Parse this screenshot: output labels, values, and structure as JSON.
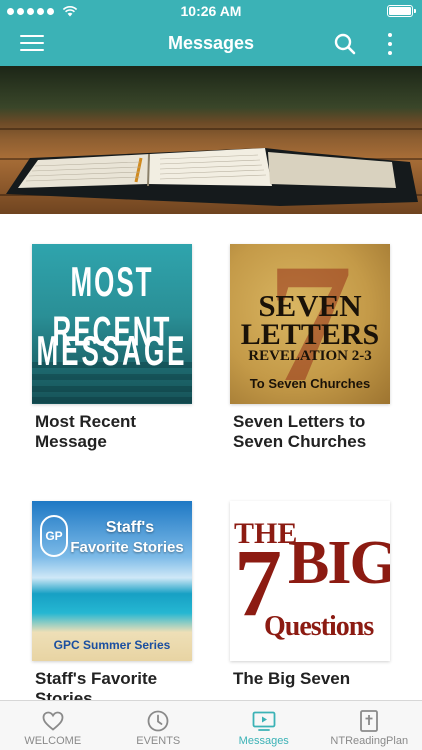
{
  "status_bar": {
    "time": "10:26 AM",
    "signal_dots": 5,
    "battery_level": 1.0
  },
  "nav": {
    "title": "Messages",
    "menu_icon": "hamburger-icon",
    "search_icon": "search-icon",
    "more_icon": "more-vertical-icon"
  },
  "hero": {
    "image": "open-bible-on-table"
  },
  "cards": [
    {
      "title": "Most Recent Message",
      "thumb_lines": [
        "MOST RECENT",
        "MESSAGE"
      ]
    },
    {
      "title": "Seven Letters to Seven Churches",
      "thumb_lines": [
        "SEVEN",
        "LETTERS",
        "REVELATION 2-3",
        "To Seven Churches"
      ],
      "thumb_numeral": "7"
    },
    {
      "title": "Staff's Favorite Stories",
      "thumb_lines": [
        "Staff's",
        "Favorite Stories",
        "GPC Summer Series"
      ],
      "thumb_logo": "GP"
    },
    {
      "title": "The Big Seven",
      "thumb_lines": [
        "THE",
        "7",
        "BIG",
        "Questions"
      ]
    }
  ],
  "tabs": [
    {
      "label": "WELCOME",
      "icon": "heart-icon",
      "active": false
    },
    {
      "label": "EVENTS",
      "icon": "clock-icon",
      "active": false
    },
    {
      "label": "Messages",
      "icon": "play-screen-icon",
      "active": true
    },
    {
      "label": "NTReadingPlan",
      "icon": "bible-cross-icon",
      "active": false
    }
  ],
  "colors": {
    "accent": "#3bb2b6",
    "tab_inactive": "#8a8a8a",
    "title_text": "#222222"
  }
}
